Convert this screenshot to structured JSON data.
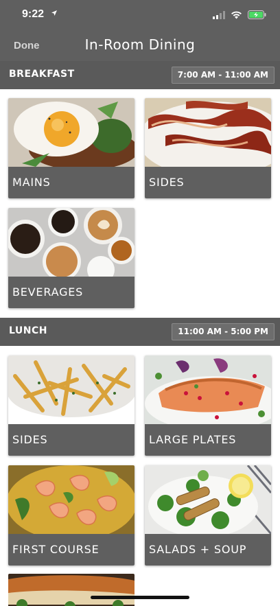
{
  "status": {
    "time": "9:22",
    "location_icon": "location-arrow-icon",
    "signal_icon": "signal-bars-icon",
    "wifi_icon": "wifi-icon",
    "battery_icon": "battery-charging-icon",
    "battery_color": "#4cd964"
  },
  "nav": {
    "done_label": "Done",
    "title": "In-Room Dining"
  },
  "breakfast": {
    "title": "BREAKFAST",
    "hours": "7:00 AM - 11:00 AM",
    "tiles": [
      {
        "label": "MAINS",
        "image": "fried-egg-plate-image"
      },
      {
        "label": "SIDES",
        "image": "bacon-strips-image"
      },
      {
        "label": "BEVERAGES",
        "image": "coffee-cups-image"
      }
    ]
  },
  "lunch": {
    "title": "LUNCH",
    "hours": "11:00 AM - 5:00 PM",
    "tiles": [
      {
        "label": "SIDES",
        "image": "french-fries-image"
      },
      {
        "label": "LARGE PLATES",
        "image": "salmon-fillet-image"
      },
      {
        "label": "FIRST COURSE",
        "image": "shrimp-bowl-image"
      },
      {
        "label": "SALADS + SOUP",
        "image": "chicken-salad-image"
      }
    ]
  },
  "colors": {
    "header_bg": "#5f5f5f",
    "section_bg": "#5a5a5a",
    "label_bg": "#5f5f5f",
    "text": "#ffffff"
  }
}
